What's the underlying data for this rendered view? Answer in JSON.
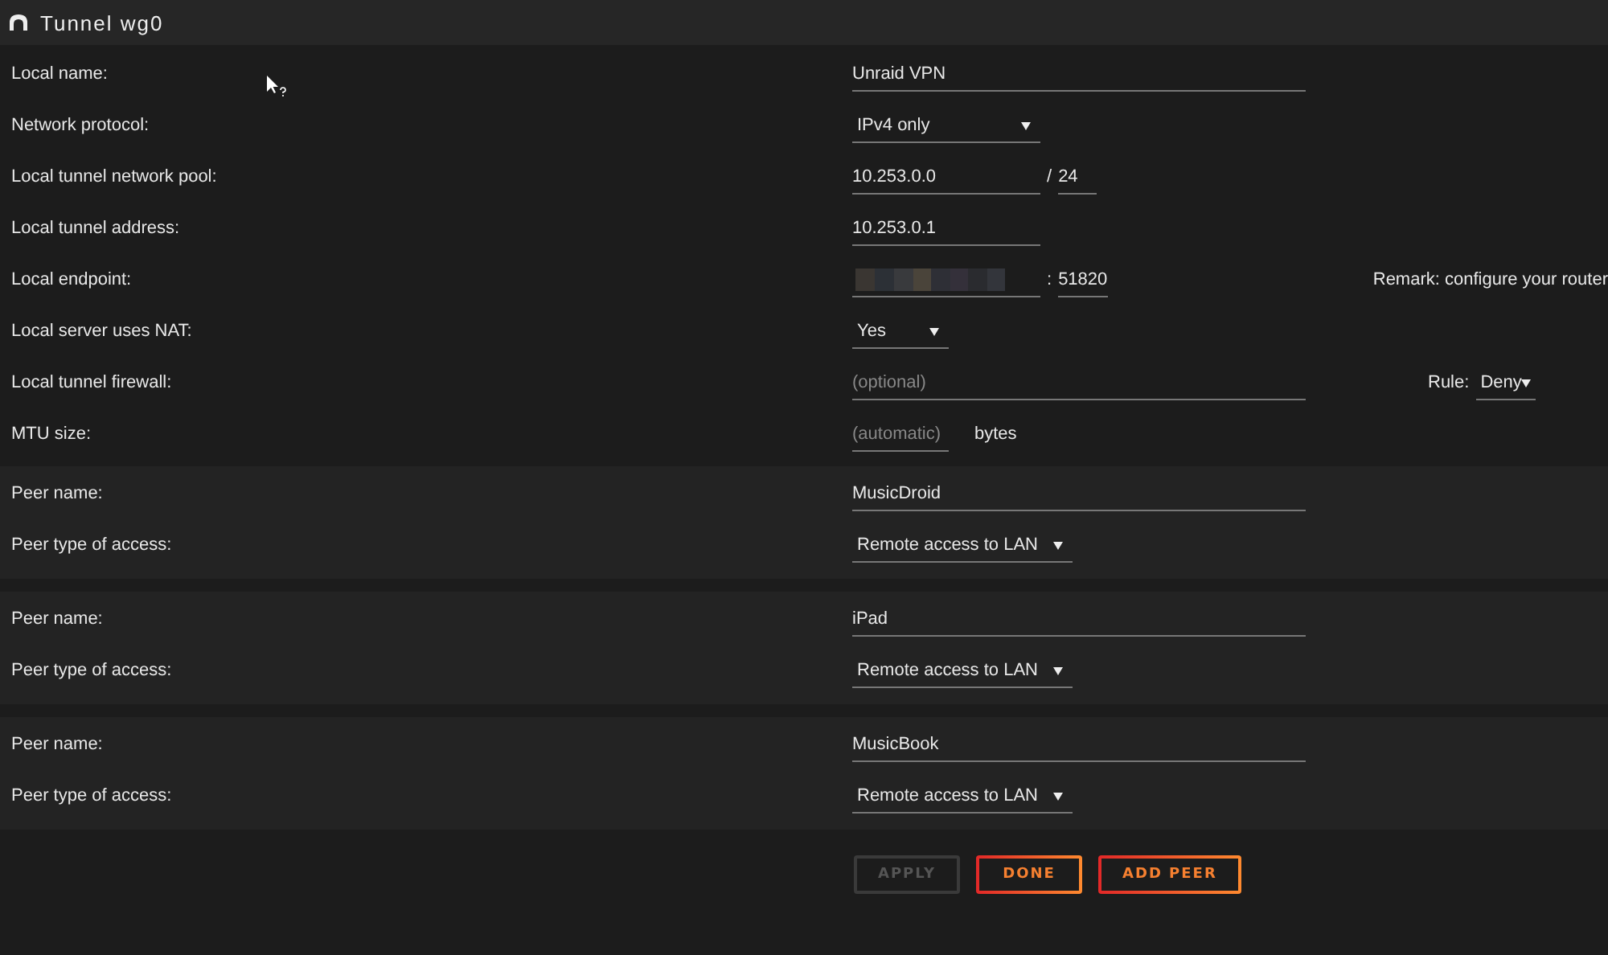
{
  "title": "Tunnel wg0",
  "settings": [
    {
      "kind": "text",
      "label": "Local name:",
      "value": "Unraid VPN"
    },
    {
      "kind": "select",
      "label": "Network protocol:",
      "value": "IPv4 only"
    },
    {
      "kind": "pool",
      "label": "Local tunnel network pool:",
      "value": "10.253.0.0",
      "separator": "/",
      "suffix": "24"
    },
    {
      "kind": "address",
      "label": "Local tunnel address:",
      "value": "10.253.0.1"
    },
    {
      "kind": "endpoint",
      "label": "Local endpoint:",
      "separator": ":",
      "suffix": "51820",
      "remark": "Remark: configure your router"
    },
    {
      "kind": "toggle",
      "label": "Local server uses NAT:",
      "value": "Yes"
    },
    {
      "kind": "firewall",
      "label": "Local tunnel firewall:",
      "placeholder": "(optional)",
      "rule_label": "Rule:",
      "rule": "Deny"
    },
    {
      "kind": "mtu",
      "label": "MTU size:",
      "placeholder": "(automatic)",
      "unit": "bytes"
    }
  ],
  "peers": [
    {
      "name_label": "Peer name:",
      "name": "MusicDroid",
      "access_label": "Peer type of access:",
      "access": "Remote access to LAN"
    },
    {
      "name_label": "Peer name:",
      "name": "iPad",
      "access_label": "Peer type of access:",
      "access": "Remote access to LAN"
    },
    {
      "name_label": "Peer name:",
      "name": "MusicBook",
      "access_label": "Peer type of access:",
      "access": "Remote access to LAN"
    }
  ],
  "buttons": [
    {
      "label": "APPLY",
      "disabled": true
    },
    {
      "label": "DONE",
      "disabled": false
    },
    {
      "label": "ADD PEER",
      "disabled": false
    }
  ]
}
